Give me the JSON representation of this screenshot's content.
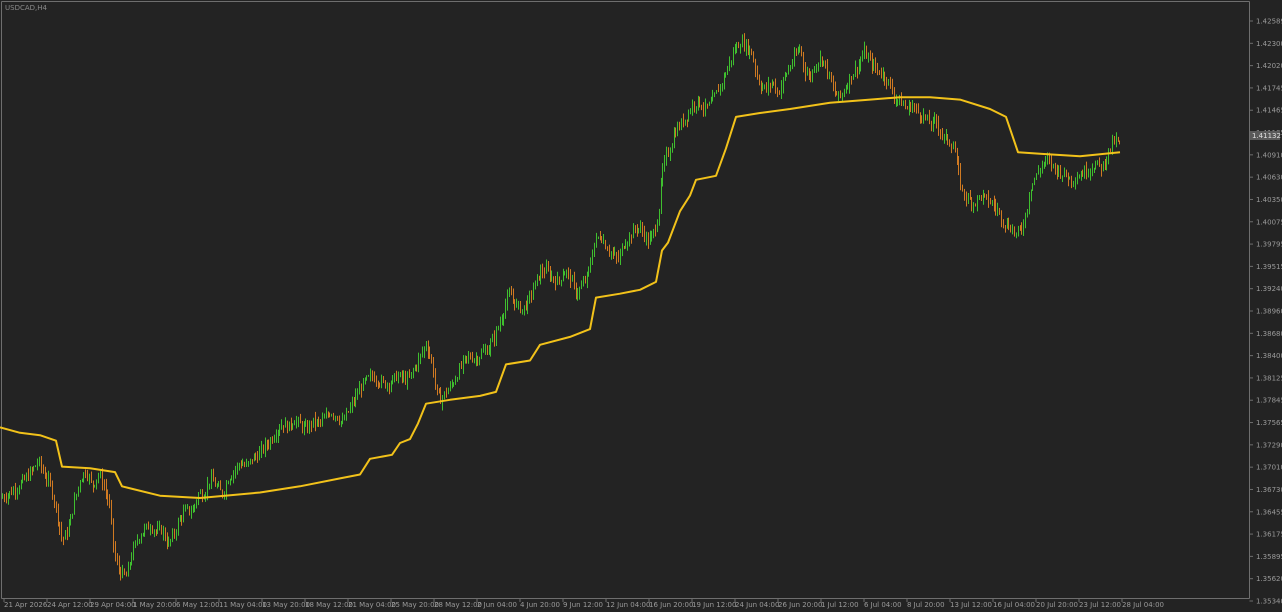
{
  "symbol_label": "USDCAD,H4",
  "current_price": "1.41132",
  "colors": {
    "background": "#232323",
    "frame": "#6e6e6e",
    "bull_bar": "#3fbf2f",
    "bear_bar": "#d07a22",
    "ma_line": "#f2c21a",
    "tick_text": "#9a9a9a",
    "price_tag_bg": "#5a5a5a"
  },
  "icons": [],
  "chart_data": {
    "type": "line",
    "title": "USDCAD,H4",
    "xlabel": "",
    "ylabel": "",
    "ylim": [
      1.3534,
      1.4272
    ],
    "grid": false,
    "y_ticks": [
      "1.42589",
      "1.42300",
      "1.42020",
      "1.41745",
      "1.41465",
      "1.41185",
      "1.40910",
      "1.40630",
      "1.40350",
      "1.40075",
      "1.39795",
      "1.39515",
      "1.39240",
      "1.38960",
      "1.38680",
      "1.38400",
      "1.38125",
      "1.37845",
      "1.37565",
      "1.37290",
      "1.37010",
      "1.36730",
      "1.36455",
      "1.36175",
      "1.35895",
      "1.35620",
      "1.35340"
    ],
    "x_ticks": [
      "21 Apr 2026",
      "24 Apr 12:00",
      "29 Apr 04:00",
      "1 May 20:00",
      "6 May 12:00",
      "11 May 04:00",
      "13 May 20:00",
      "18 May 12:00",
      "21 May 04:00",
      "25 May 20:00",
      "28 May 12:00",
      "2 Jun 04:00",
      "4 Jun 20:00",
      "9 Jun 12:00",
      "12 Jun 04:00",
      "16 Jun 20:00",
      "19 Jun 12:00",
      "24 Jun 04:00",
      "26 Jun 20:00",
      "1 Jul 12:00",
      "6 Jul 04:00",
      "8 Jul 20:00",
      "13 Jul 12:00",
      "16 Jul 04:00",
      "20 Jul 20:00",
      "23 Jul 12:00",
      "28 Jul 04:00"
    ],
    "price_series": [
      [
        0,
        1.3665
      ],
      [
        8,
        1.367
      ],
      [
        16,
        1.3678
      ],
      [
        24,
        1.3688
      ],
      [
        32,
        1.37
      ],
      [
        38,
        1.3712
      ],
      [
        44,
        1.3695
      ],
      [
        50,
        1.3682
      ],
      [
        56,
        1.365
      ],
      [
        62,
        1.361
      ],
      [
        68,
        1.3625
      ],
      [
        74,
        1.366
      ],
      [
        80,
        1.369
      ],
      [
        86,
        1.37
      ],
      [
        92,
        1.368
      ],
      [
        98,
        1.3695
      ],
      [
        104,
        1.368
      ],
      [
        110,
        1.365
      ],
      [
        114,
        1.359
      ],
      [
        120,
        1.357
      ],
      [
        126,
        1.3565
      ],
      [
        132,
        1.3595
      ],
      [
        138,
        1.3615
      ],
      [
        144,
        1.3625
      ],
      [
        150,
        1.363
      ],
      [
        156,
        1.3622
      ],
      [
        162,
        1.3625
      ],
      [
        168,
        1.3605
      ],
      [
        174,
        1.362
      ],
      [
        180,
        1.364
      ],
      [
        186,
        1.365
      ],
      [
        192,
        1.3648
      ],
      [
        198,
        1.367
      ],
      [
        204,
        1.367
      ],
      [
        210,
        1.369
      ],
      [
        216,
        1.368
      ],
      [
        222,
        1.367
      ],
      [
        228,
        1.369
      ],
      [
        234,
        1.37
      ],
      [
        240,
        1.371
      ],
      [
        246,
        1.3705
      ],
      [
        252,
        1.3715
      ],
      [
        258,
        1.372
      ],
      [
        264,
        1.373
      ],
      [
        270,
        1.3738
      ],
      [
        276,
        1.375
      ],
      [
        282,
        1.376
      ],
      [
        288,
        1.3755
      ],
      [
        294,
        1.3765
      ],
      [
        300,
        1.3758
      ],
      [
        306,
        1.3752
      ],
      [
        312,
        1.3762
      ],
      [
        318,
        1.376
      ],
      [
        324,
        1.3765
      ],
      [
        330,
        1.3775
      ],
      [
        336,
        1.377
      ],
      [
        342,
        1.376
      ],
      [
        348,
        1.3775
      ],
      [
        354,
        1.379
      ],
      [
        360,
        1.3805
      ],
      [
        366,
        1.3815
      ],
      [
        372,
        1.382
      ],
      [
        378,
        1.3815
      ],
      [
        384,
        1.381
      ],
      [
        390,
        1.3812
      ],
      [
        396,
        1.382
      ],
      [
        402,
        1.3818
      ],
      [
        408,
        1.3815
      ],
      [
        414,
        1.383
      ],
      [
        420,
        1.3845
      ],
      [
        426,
        1.3862
      ],
      [
        432,
        1.3835
      ],
      [
        436,
        1.38
      ],
      [
        440,
        1.379
      ],
      [
        446,
        1.38
      ],
      [
        452,
        1.381
      ],
      [
        458,
        1.3825
      ],
      [
        464,
        1.384
      ],
      [
        470,
        1.3845
      ],
      [
        476,
        1.3842
      ],
      [
        482,
        1.385
      ],
      [
        488,
        1.3855
      ],
      [
        494,
        1.387
      ],
      [
        500,
        1.389
      ],
      [
        506,
        1.3915
      ],
      [
        510,
        1.3925
      ],
      [
        516,
        1.391
      ],
      [
        522,
        1.3905
      ],
      [
        528,
        1.3915
      ],
      [
        534,
        1.3935
      ],
      [
        540,
        1.3952
      ],
      [
        546,
        1.3955
      ],
      [
        552,
        1.3945
      ],
      [
        558,
        1.394
      ],
      [
        564,
        1.3955
      ],
      [
        570,
        1.3945
      ],
      [
        576,
        1.3925
      ],
      [
        582,
        1.3935
      ],
      [
        588,
        1.395
      ],
      [
        594,
        1.399
      ],
      [
        600,
        1.4
      ],
      [
        606,
        1.3985
      ],
      [
        612,
        1.3975
      ],
      [
        618,
        1.3968
      ],
      [
        624,
        1.399
      ],
      [
        630,
        1.3998
      ],
      [
        636,
        1.401
      ],
      [
        642,
        1.4005
      ],
      [
        648,
        1.399
      ],
      [
        654,
        1.4005
      ],
      [
        658,
        1.4025
      ],
      [
        662,
        1.408
      ],
      [
        666,
        1.41
      ],
      [
        670,
        1.411
      ],
      [
        674,
        1.413
      ],
      [
        680,
        1.414
      ],
      [
        686,
        1.415
      ],
      [
        692,
        1.4165
      ],
      [
        698,
        1.417
      ],
      [
        704,
        1.416
      ],
      [
        710,
        1.4165
      ],
      [
        716,
        1.418
      ],
      [
        722,
        1.4195
      ],
      [
        728,
        1.4215
      ],
      [
        734,
        1.4235
      ],
      [
        740,
        1.4245
      ],
      [
        746,
        1.424
      ],
      [
        752,
        1.423
      ],
      [
        756,
        1.4205
      ],
      [
        760,
        1.419
      ],
      [
        766,
        1.4185
      ],
      [
        772,
        1.4195
      ],
      [
        778,
        1.418
      ],
      [
        784,
        1.42
      ],
      [
        790,
        1.4215
      ],
      [
        796,
        1.423
      ],
      [
        800,
        1.424
      ],
      [
        804,
        1.421
      ],
      [
        810,
        1.42
      ],
      [
        816,
        1.422
      ],
      [
        822,
        1.4225
      ],
      [
        828,
        1.4205
      ],
      [
        834,
        1.418
      ],
      [
        840,
        1.4175
      ],
      [
        846,
        1.419
      ],
      [
        852,
        1.4205
      ],
      [
        858,
        1.4215
      ],
      [
        864,
        1.4232
      ],
      [
        870,
        1.422
      ],
      [
        876,
        1.421
      ],
      [
        882,
        1.4205
      ],
      [
        888,
        1.4195
      ],
      [
        894,
        1.4175
      ],
      [
        900,
        1.417
      ],
      [
        906,
        1.416
      ],
      [
        912,
        1.4165
      ],
      [
        918,
        1.4155
      ],
      [
        924,
        1.415
      ],
      [
        930,
        1.414
      ],
      [
        936,
        1.4145
      ],
      [
        942,
        1.4125
      ],
      [
        948,
        1.412
      ],
      [
        954,
        1.411
      ],
      [
        958,
        1.408
      ],
      [
        962,
        1.4055
      ],
      [
        968,
        1.4045
      ],
      [
        974,
        1.404
      ],
      [
        980,
        1.405
      ],
      [
        986,
        1.4045
      ],
      [
        992,
        1.404
      ],
      [
        998,
        1.403
      ],
      [
        1004,
        1.4015
      ],
      [
        1010,
        1.401
      ],
      [
        1016,
        1.4
      ],
      [
        1022,
        1.401
      ],
      [
        1026,
        1.403
      ],
      [
        1030,
        1.406
      ],
      [
        1036,
        1.4075
      ],
      [
        1042,
        1.409
      ],
      [
        1048,
        1.4095
      ],
      [
        1054,
        1.4085
      ],
      [
        1060,
        1.408
      ],
      [
        1066,
        1.4075
      ],
      [
        1072,
        1.407
      ],
      [
        1078,
        1.4075
      ],
      [
        1084,
        1.408
      ],
      [
        1090,
        1.4085
      ],
      [
        1096,
        1.409
      ],
      [
        1102,
        1.4085
      ],
      [
        1108,
        1.4105
      ],
      [
        1114,
        1.412
      ],
      [
        1120,
        1.4115
      ]
    ],
    "ma_series": [
      [
        0,
        1.3755
      ],
      [
        20,
        1.3748
      ],
      [
        40,
        1.3745
      ],
      [
        56,
        1.3738
      ],
      [
        62,
        1.3705
      ],
      [
        90,
        1.3703
      ],
      [
        115,
        1.3698
      ],
      [
        122,
        1.368
      ],
      [
        160,
        1.3668
      ],
      [
        200,
        1.3665
      ],
      [
        260,
        1.3672
      ],
      [
        300,
        1.368
      ],
      [
        340,
        1.369
      ],
      [
        360,
        1.3695
      ],
      [
        370,
        1.3715
      ],
      [
        392,
        1.372
      ],
      [
        400,
        1.3735
      ],
      [
        410,
        1.374
      ],
      [
        418,
        1.376
      ],
      [
        426,
        1.3785
      ],
      [
        450,
        1.379
      ],
      [
        480,
        1.3795
      ],
      [
        496,
        1.38
      ],
      [
        506,
        1.3835
      ],
      [
        530,
        1.384
      ],
      [
        540,
        1.386
      ],
      [
        570,
        1.387
      ],
      [
        590,
        1.388
      ],
      [
        596,
        1.392
      ],
      [
        620,
        1.3925
      ],
      [
        640,
        1.393
      ],
      [
        656,
        1.394
      ],
      [
        662,
        1.398
      ],
      [
        668,
        1.399
      ],
      [
        680,
        1.403
      ],
      [
        690,
        1.405
      ],
      [
        696,
        1.407
      ],
      [
        716,
        1.4075
      ],
      [
        726,
        1.411
      ],
      [
        736,
        1.415
      ],
      [
        760,
        1.4155
      ],
      [
        790,
        1.416
      ],
      [
        830,
        1.4168
      ],
      [
        870,
        1.4172
      ],
      [
        900,
        1.4175
      ],
      [
        930,
        1.4175
      ],
      [
        960,
        1.4172
      ],
      [
        990,
        1.416
      ],
      [
        1006,
        1.415
      ],
      [
        1018,
        1.4105
      ],
      [
        1040,
        1.4103
      ],
      [
        1080,
        1.41
      ],
      [
        1120,
        1.4105
      ]
    ]
  }
}
